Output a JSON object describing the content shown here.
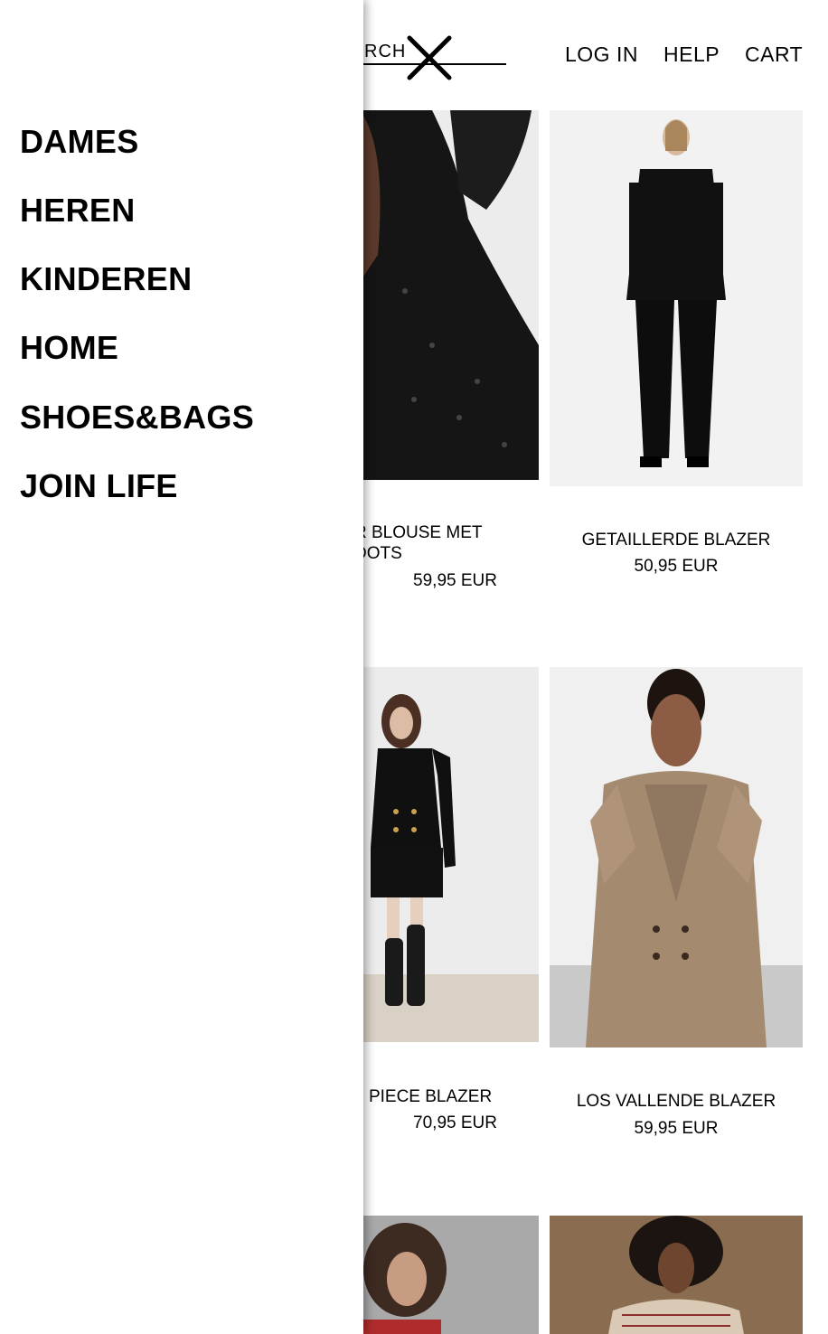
{
  "header": {
    "search_label": "SEARCH",
    "login_label": "LOG IN",
    "help_label": "HELP",
    "cart_label": "CART",
    "close_icon": "close-x-icon"
  },
  "drawer": {
    "items": [
      {
        "label": "DAMES"
      },
      {
        "label": "HEREN"
      },
      {
        "label": "KINDEREN"
      },
      {
        "label": "HOME"
      },
      {
        "label": "SHOES&BAGS"
      },
      {
        "label": "JOIN LIFE"
      }
    ]
  },
  "products": [
    {
      "name_line1": "R BLOUSE MET",
      "name_line2": "DOTS",
      "price": "59,95 EUR"
    },
    {
      "name": "GETAILLERDE BLAZER",
      "price": "50,95 EUR"
    },
    {
      "name": "E PIECE BLAZER",
      "price": "70,95 EUR"
    },
    {
      "name": "LOS VALLENDE BLAZER",
      "price": "59,95 EUR"
    }
  ]
}
